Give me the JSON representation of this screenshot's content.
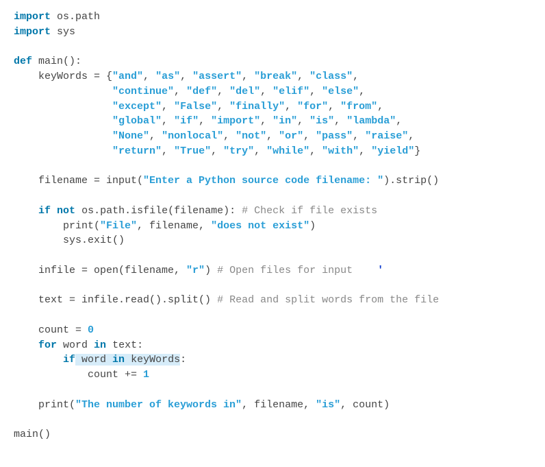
{
  "code": {
    "l01_import": "import",
    "l01_rest": " os.path",
    "l02_import": "import",
    "l02_rest": " sys",
    "l04_def": "def",
    "l04_rest": " main():",
    "l05_pre": "    keyWords = {",
    "l05_s1": "\"and\"",
    "l05_s2": "\"as\"",
    "l05_s3": "\"assert\"",
    "l05_s4": "\"break\"",
    "l05_s5": "\"class\"",
    "l06_pad": "                ",
    "l06_s1": "\"continue\"",
    "l06_s2": "\"def\"",
    "l06_s3": "\"del\"",
    "l06_s4": "\"elif\"",
    "l06_s5": "\"else\"",
    "l07_pad": "                ",
    "l07_s1": "\"except\"",
    "l07_s2": "\"False\"",
    "l07_s3": "\"finally\"",
    "l07_s4": "\"for\"",
    "l07_s5": "\"from\"",
    "l08_pad": "                ",
    "l08_s1": "\"global\"",
    "l08_s2": "\"if\"",
    "l08_s3": "\"import\"",
    "l08_s4": "\"in\"",
    "l08_s5": "\"is\"",
    "l08_s6": "\"lambda\"",
    "l09_pad": "                ",
    "l09_s1": "\"None\"",
    "l09_s2": "\"nonlocal\"",
    "l09_s3": "\"not\"",
    "l09_s4": "\"or\"",
    "l09_s5": "\"pass\"",
    "l09_s6": "\"raise\"",
    "l10_pad": "                ",
    "l10_s1": "\"return\"",
    "l10_s2": "\"True\"",
    "l10_s3": "\"try\"",
    "l10_s4": "\"while\"",
    "l10_s5": "\"with\"",
    "l10_s6": "\"yield\"",
    "l10_end": "}",
    "l12_pre": "    filename = input(",
    "l12_str": "\"Enter a Python source code filename: \"",
    "l12_post": ").strip()",
    "l14_ind": "    ",
    "l14_if": "if",
    "l14_sp": " ",
    "l14_not": "not",
    "l14_rest": " os.path.isfile(filename): ",
    "l14_com": "# Check if file exists",
    "l15_pre": "        print(",
    "l15_s1": "\"File\"",
    "l15_mid": ", filename, ",
    "l15_s2": "\"does not exist\"",
    "l15_post": ")",
    "l16": "        sys.exit()",
    "l18_pre": "    infile = open(filename, ",
    "l18_str": "\"r\"",
    "l18_post": ") ",
    "l18_com": "# Open files for input",
    "l18_cursor": "    '",
    "l20_pre": "    text = infile.read().split() ",
    "l20_com": "# Read and split words from the file",
    "l22_pre": "    count = ",
    "l22_num": "0",
    "l23_ind": "    ",
    "l23_for": "for",
    "l23_mid1": " word ",
    "l23_in": "in",
    "l23_rest": " text:",
    "l24_ind": "        ",
    "l24_if": "if",
    "l24_hl1": " word ",
    "l24_in": "in",
    "l24_hl2": " keyWords",
    "l24_colon": ":",
    "l25_pre": "            count += ",
    "l25_num": "1",
    "l27_pre": "    print(",
    "l27_s1": "\"The number of keywords in\"",
    "l27_mid1": ", filename, ",
    "l27_s2": "\"is\"",
    "l27_post": ", count)",
    "l29": "main()"
  },
  "sep": ", "
}
